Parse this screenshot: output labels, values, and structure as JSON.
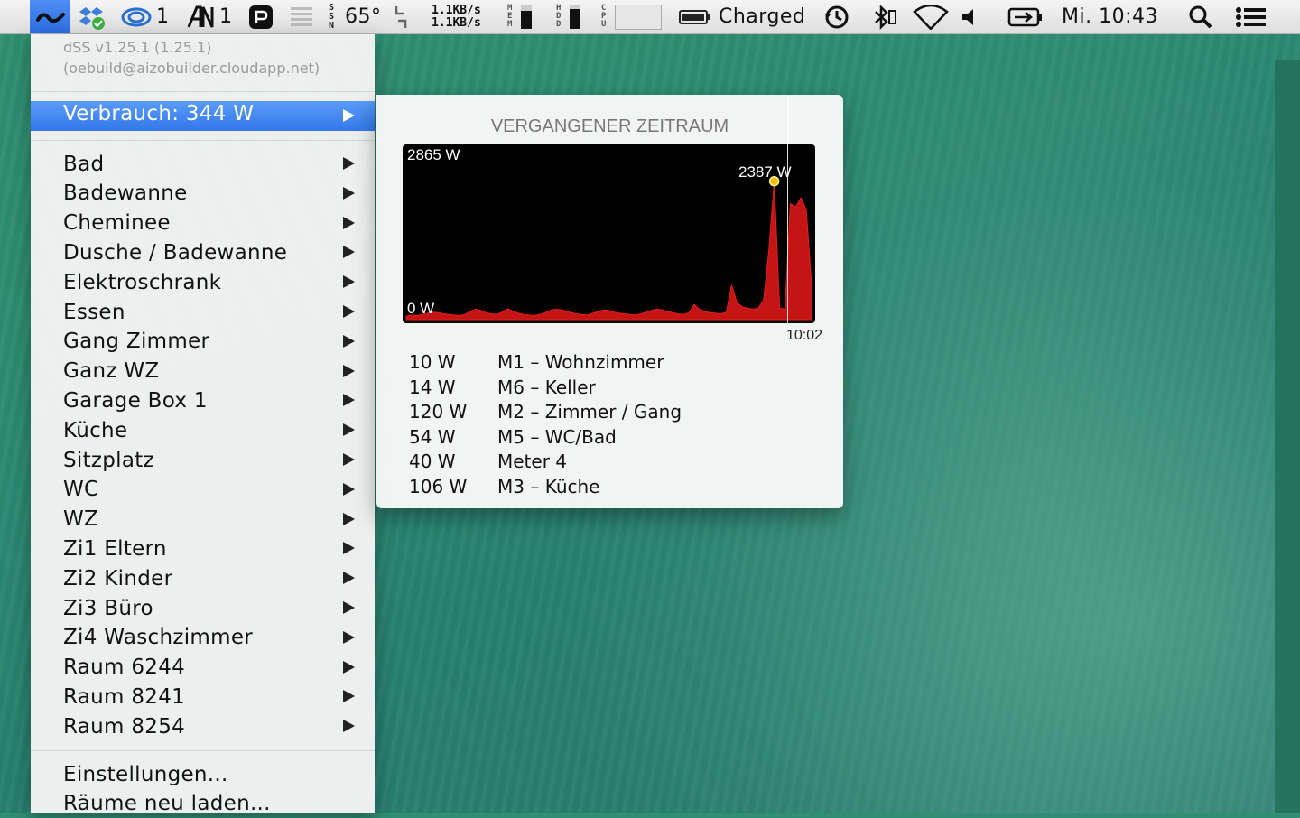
{
  "menubar": {
    "cloud_count": "1",
    "font_count": "1",
    "weather_dir": "SSN",
    "temperature": "65°",
    "net_up": "1.1KB/s",
    "net_down": "1.1KB/s",
    "mem_label": "MEM",
    "hdd_label": "HDD",
    "cpu_label": "CPU",
    "battery_status": "Charged",
    "clock": "Mi. 10:43"
  },
  "menu": {
    "version": "dSS v1.25.1 (1.25.1)",
    "build_host": "(oebuild@aizobuilder.cloudapp.net)",
    "consumption_label": "Verbrauch: 344 W",
    "rooms": [
      "Bad",
      "Badewanne",
      "Cheminee",
      "Dusche / Badewanne",
      "Elektroschrank",
      "Essen",
      "Gang Zimmer",
      "Ganz WZ",
      "Garage Box 1",
      "Küche",
      "Sitzplatz",
      "WC",
      "WZ",
      "Zi1 Eltern",
      "Zi2 Kinder",
      "Zi3 Büro",
      "Zi4 Waschzimmer",
      "Raum 6244",
      "Raum 8241",
      "Raum 8254"
    ],
    "settings_label": "Einstellungen...",
    "reload_label": "Räume neu laden..."
  },
  "submenu": {
    "title": "VERGANGENER ZEITRAUM",
    "time_label": "10:02",
    "meters": [
      {
        "value": "10 W",
        "name": "M1 – Wohnzimmer"
      },
      {
        "value": "14 W",
        "name": "M6 – Keller"
      },
      {
        "value": "120 W",
        "name": "M2 – Zimmer / Gang"
      },
      {
        "value": "54 W",
        "name": "M5 – WC/Bad"
      },
      {
        "value": "40 W",
        "name": "Meter 4"
      },
      {
        "value": "106 W",
        "name": "M3 – Küche"
      }
    ]
  },
  "chart_data": {
    "type": "area",
    "max_label": "2865 W",
    "min_label": "0 W",
    "marker_label": "2387 W",
    "ylim": [
      0,
      2865
    ],
    "color": "#c41414",
    "marker_index": 69,
    "values": [
      60,
      80,
      70,
      90,
      110,
      130,
      120,
      100,
      90,
      80,
      70,
      90,
      140,
      180,
      160,
      120,
      100,
      90,
      130,
      190,
      150,
      110,
      90,
      80,
      70,
      90,
      120,
      160,
      180,
      170,
      150,
      120,
      100,
      90,
      80,
      110,
      140,
      170,
      160,
      130,
      110,
      100,
      90,
      80,
      100,
      130,
      160,
      180,
      170,
      140,
      120,
      100,
      90,
      120,
      260,
      180,
      140,
      120,
      110,
      100,
      130,
      600,
      300,
      220,
      200,
      180,
      200,
      340,
      1200,
      2387,
      200,
      180,
      2000,
      1950,
      2100,
      1900,
      600
    ]
  }
}
